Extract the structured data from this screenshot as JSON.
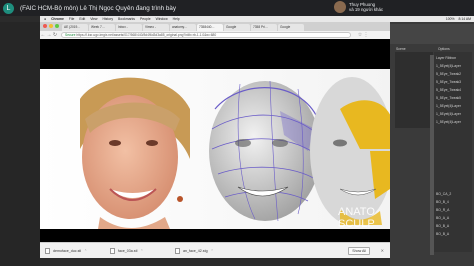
{
  "meeting": {
    "avatar_letter": "L",
    "title": "(FAIC HCM-Bộ môn) Lê Thị Ngọc Quyên đang trình bày",
    "presenter_name": "Thuy Phuong",
    "presenter_others": "và 19 người khác"
  },
  "mac_menu": {
    "items": [
      "Chrome",
      "File",
      "Edit",
      "View",
      "History",
      "Bookmarks",
      "People",
      "Window",
      "Help"
    ],
    "battery": "100%",
    "clock": "8:14 AM"
  },
  "chrome": {
    "tabs": [
      "AE (2019…",
      "Week 7…",
      "Inbox -",
      "Vimeo -",
      "anatomy…",
      "7358440…",
      "Google",
      "7358 Pri…",
      "Google"
    ],
    "active_tab_index": 5,
    "url_secure_label": "Secure",
    "url": "https://i.ksr-ugc.imgix.net/assets/017/568/440/8d4f6d3d3a85_original.png?ixlib=rb-1.1.0&w=680",
    "downloads": [
      {
        "name": "demoface_duc.stl"
      },
      {
        "name": "face_03a.stl"
      },
      {
        "name": "an_face_42.stg"
      }
    ],
    "show_all": "Show All"
  },
  "page_image": {
    "watermark_line1": "ANATO",
    "watermark_line2": "SCULP"
  },
  "right_panel": {
    "tabs": [
      "Scene",
      "Options"
    ],
    "list_items": [
      "Layer Ribbon",
      "1_5Eyel(4)Layer",
      "5_5Eye_Tweak2",
      "5_5Eye_Tweak3",
      "5_5Eye_Tweak4",
      "5_5Eye_Tweak5",
      "1_5Eyel(4)Layer",
      "1_5Eyel(4)Layer",
      "1_5Eyel(4)Layer"
    ],
    "bottom_items": [
      "BO_CA_2",
      "BO_B_4",
      "BO_R_A",
      "BO_A_A",
      "BO_B_A",
      "BO_B_A"
    ]
  },
  "colors": {
    "meeting_bar": "#202124",
    "chrome_bg": "#f2f2f2",
    "secure_green": "#1a8a3a",
    "mesh_purple": "#6a5cc8",
    "muscle_yellow": "#e8b820"
  }
}
